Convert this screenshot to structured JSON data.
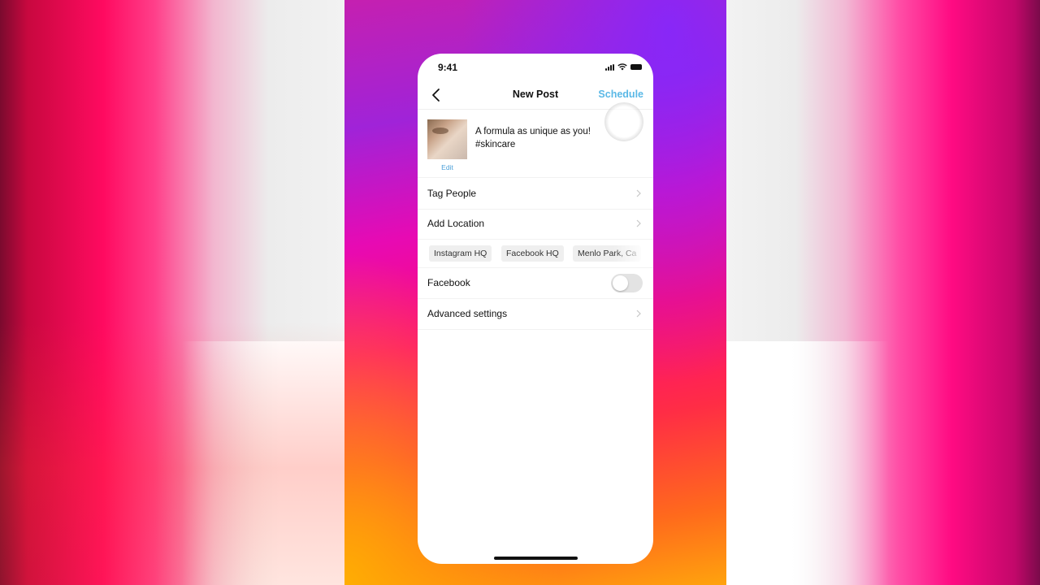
{
  "status_bar": {
    "time": "9:41"
  },
  "nav": {
    "title": "New Post",
    "schedule_label": "Schedule"
  },
  "post": {
    "caption_line1": "A formula as unique as you!",
    "caption_line2": "#skincare",
    "edit_label": "Edit"
  },
  "rows": {
    "tag_people": "Tag People",
    "add_location": "Add Location",
    "facebook": "Facebook",
    "advanced_settings": "Advanced settings"
  },
  "location_chips": [
    "Instagram HQ",
    "Facebook HQ",
    "Menlo Park, Ca"
  ],
  "facebook_toggle": {
    "on": false
  },
  "colors": {
    "accent": "#5ab8e6",
    "edit_link": "#4a9fd8",
    "toggle_off": "#e3e3e3"
  }
}
